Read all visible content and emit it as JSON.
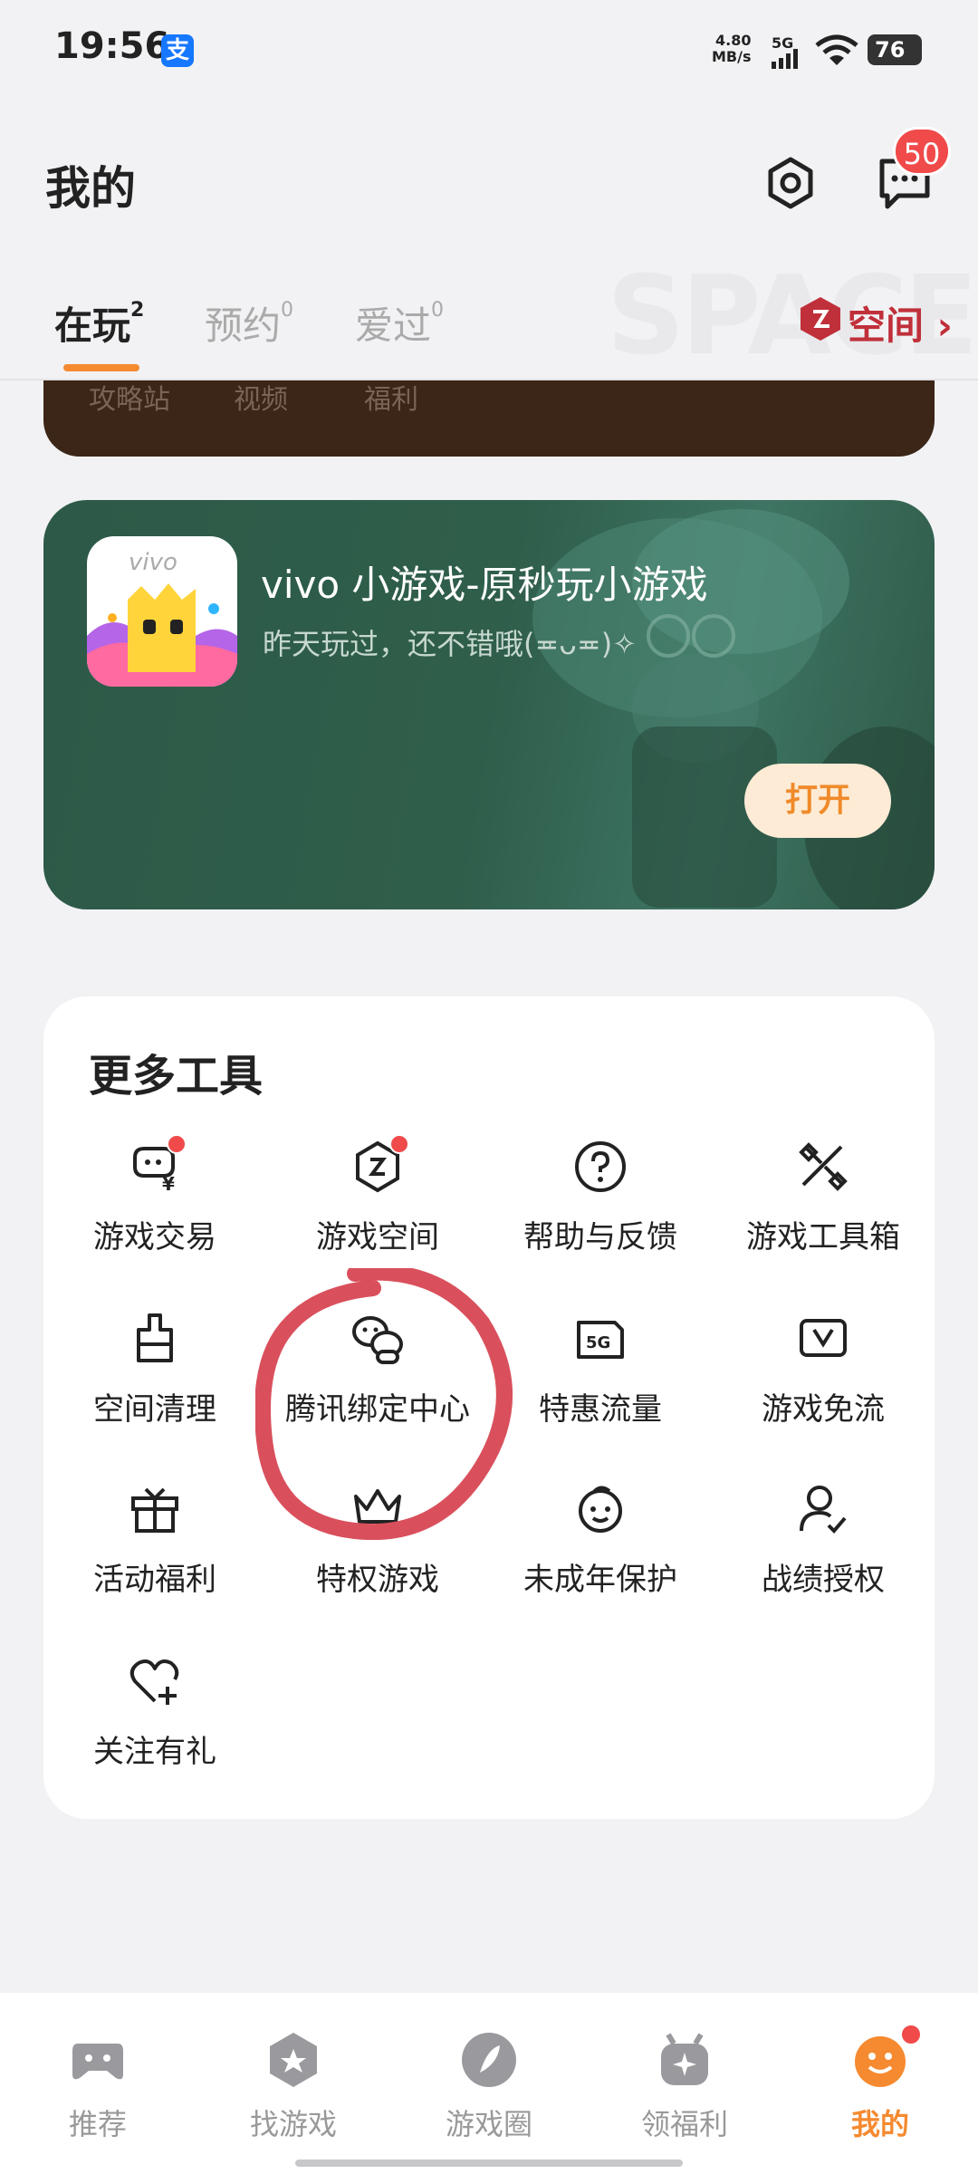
{
  "status_bar": {
    "time": "19:56",
    "alipay_glyph": "支",
    "speed_value": "4.80",
    "speed_unit": "MB/s",
    "network": "5G",
    "battery": "76"
  },
  "header": {
    "title": "我的",
    "message_count": "50"
  },
  "tabs": [
    {
      "label": "在玩",
      "count": "2",
      "active": true
    },
    {
      "label": "预约",
      "count": "0",
      "active": false
    },
    {
      "label": "爱过",
      "count": "0",
      "active": false
    }
  ],
  "space_entry": {
    "watermark": "SPACE",
    "label": "空间 ›"
  },
  "dark_card_partial": {
    "items": [
      "攻略站",
      "视频",
      "福利"
    ]
  },
  "game_card": {
    "name": "vivo 小游戏-原秒玩小游戏",
    "description": "昨天玩过，还不错哦(≖ᴗ≖)✧",
    "icon_brand": "vivo",
    "open_label": "打开"
  },
  "tools": {
    "title": "更多工具",
    "items": [
      {
        "label": "游戏交易",
        "icon": "game-trade-icon",
        "badge": true
      },
      {
        "label": "游戏空间",
        "icon": "game-space-icon",
        "badge": true
      },
      {
        "label": "帮助与反馈",
        "icon": "help-icon",
        "badge": false
      },
      {
        "label": "游戏工具箱",
        "icon": "toolbox-icon",
        "badge": false
      },
      {
        "label": "空间清理",
        "icon": "clean-icon",
        "badge": false
      },
      {
        "label": "腾讯绑定中心",
        "icon": "wechat-link-icon",
        "badge": false
      },
      {
        "label": "特惠流量",
        "icon": "5g-sim-icon",
        "badge": false,
        "icon_text": "5G"
      },
      {
        "label": "游戏免流",
        "icon": "free-data-icon",
        "badge": false
      },
      {
        "label": "活动福利",
        "icon": "gift-icon",
        "badge": false
      },
      {
        "label": "特权游戏",
        "icon": "crown-icon",
        "badge": false
      },
      {
        "label": "未成年保护",
        "icon": "child-protect-icon",
        "badge": false
      },
      {
        "label": "战绩授权",
        "icon": "user-check-icon",
        "badge": false
      },
      {
        "label": "关注有礼",
        "icon": "heart-plus-icon",
        "badge": false
      }
    ]
  },
  "bottom_nav": [
    {
      "label": "推荐",
      "icon": "gamepad-icon",
      "active": false
    },
    {
      "label": "找游戏",
      "icon": "discover-icon",
      "active": false
    },
    {
      "label": "游戏圈",
      "icon": "feather-icon",
      "active": false
    },
    {
      "label": "领福利",
      "icon": "gift-bag-icon",
      "active": false
    },
    {
      "label": "我的",
      "icon": "smiley-icon",
      "active": true,
      "badge": true
    }
  ],
  "colors": {
    "accent": "#f58a30",
    "badge": "#f04a4a",
    "game_card_bg": "#2f5e4b",
    "annotation": "#d9505c"
  }
}
